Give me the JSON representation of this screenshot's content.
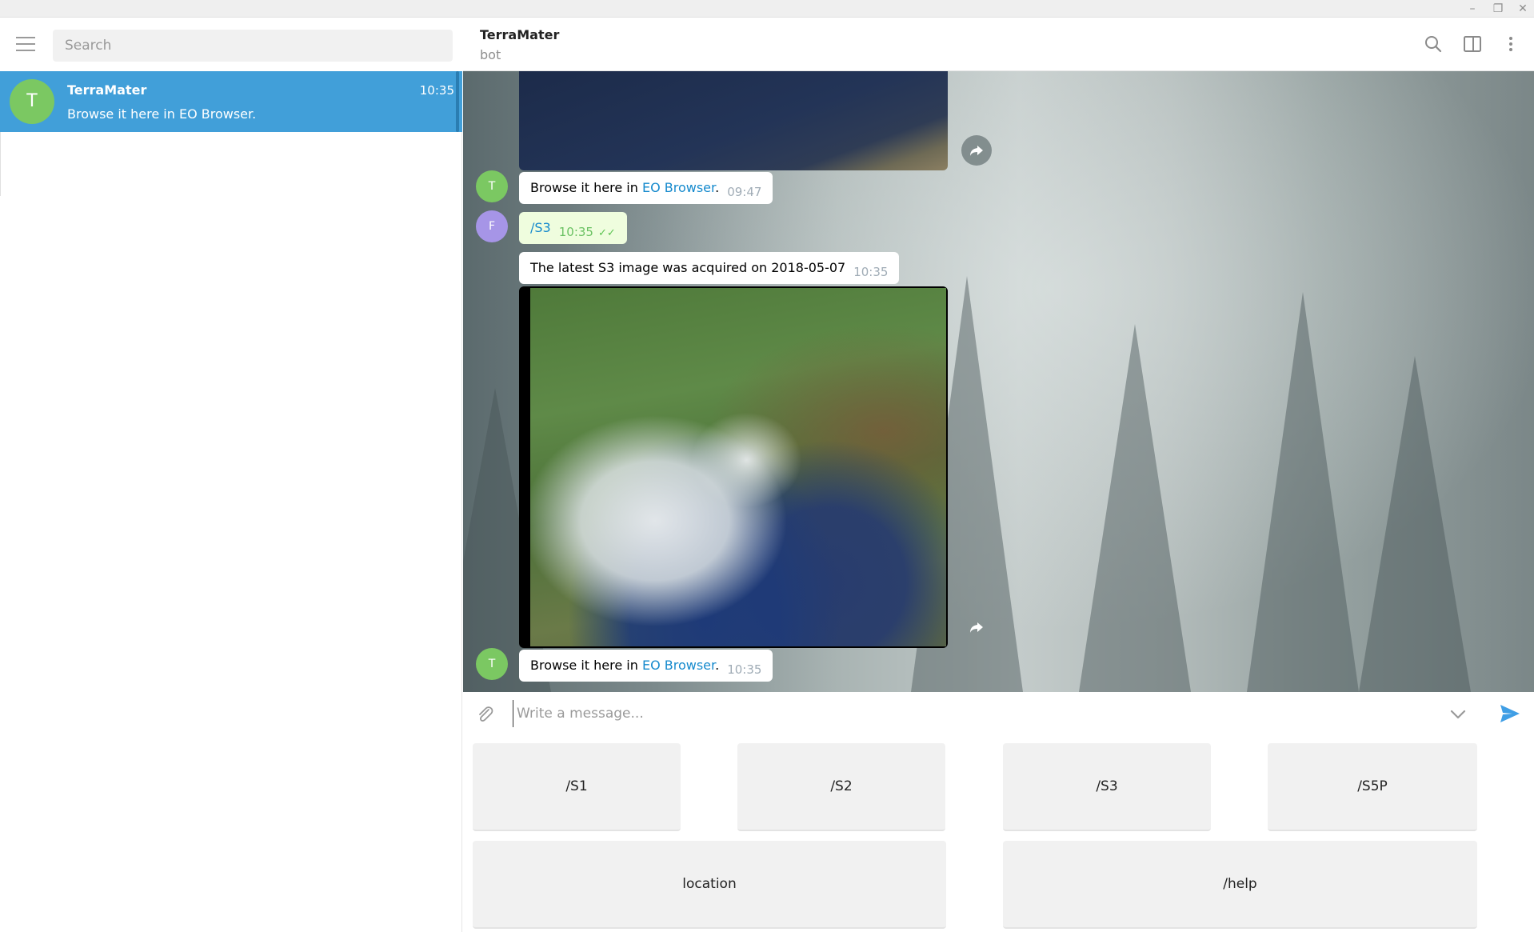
{
  "window": {
    "controls": {
      "minimize": "–",
      "maximize": "❐",
      "close": "✕"
    }
  },
  "sidebar": {
    "search": {
      "placeholder": "Search",
      "value": ""
    },
    "chats": [
      {
        "avatar_letter": "T",
        "name": "TerraMater",
        "time": "10:35",
        "preview": "Browse it here in EO Browser.",
        "selected": true,
        "avatar_color": "#7bc862"
      }
    ]
  },
  "header": {
    "title": "TerraMater",
    "status": "bot",
    "icons": [
      "search-icon",
      "side-panel-icon",
      "more-vertical-icon"
    ]
  },
  "messages": [
    {
      "type": "image",
      "sender": "T",
      "description_icon": "satellite-image-partial"
    },
    {
      "type": "text",
      "sender_letter": "T",
      "text_before": "Browse it here in ",
      "link": "EO Browser",
      "text_after": ".",
      "time": "09:47"
    },
    {
      "type": "text",
      "direction": "out",
      "sender_letter": "F",
      "text": "/S3",
      "time": "10:35",
      "status": "read"
    },
    {
      "type": "text",
      "sender_letter": "T",
      "text": "The latest S3 image was acquired on 2018-05-07",
      "time": "10:35"
    },
    {
      "type": "image",
      "sender": "T",
      "description_icon": "satellite-image"
    },
    {
      "type": "text",
      "sender_letter": "T",
      "text_before": "Browse it here in ",
      "link": "EO Browser",
      "text_after": ".",
      "time": "10:35"
    }
  ],
  "composer": {
    "placeholder": "Write a message...",
    "value": ""
  },
  "keyboard": {
    "row1": [
      "/S1",
      "/S2",
      "/S3",
      "/S5P"
    ],
    "row2": [
      "location",
      "/help"
    ]
  },
  "colors": {
    "accent": "#419fd9",
    "link": "#168acd",
    "avatar_green": "#7bc862",
    "avatar_purple": "#a695e7",
    "outgoing_bubble": "#effdde"
  }
}
